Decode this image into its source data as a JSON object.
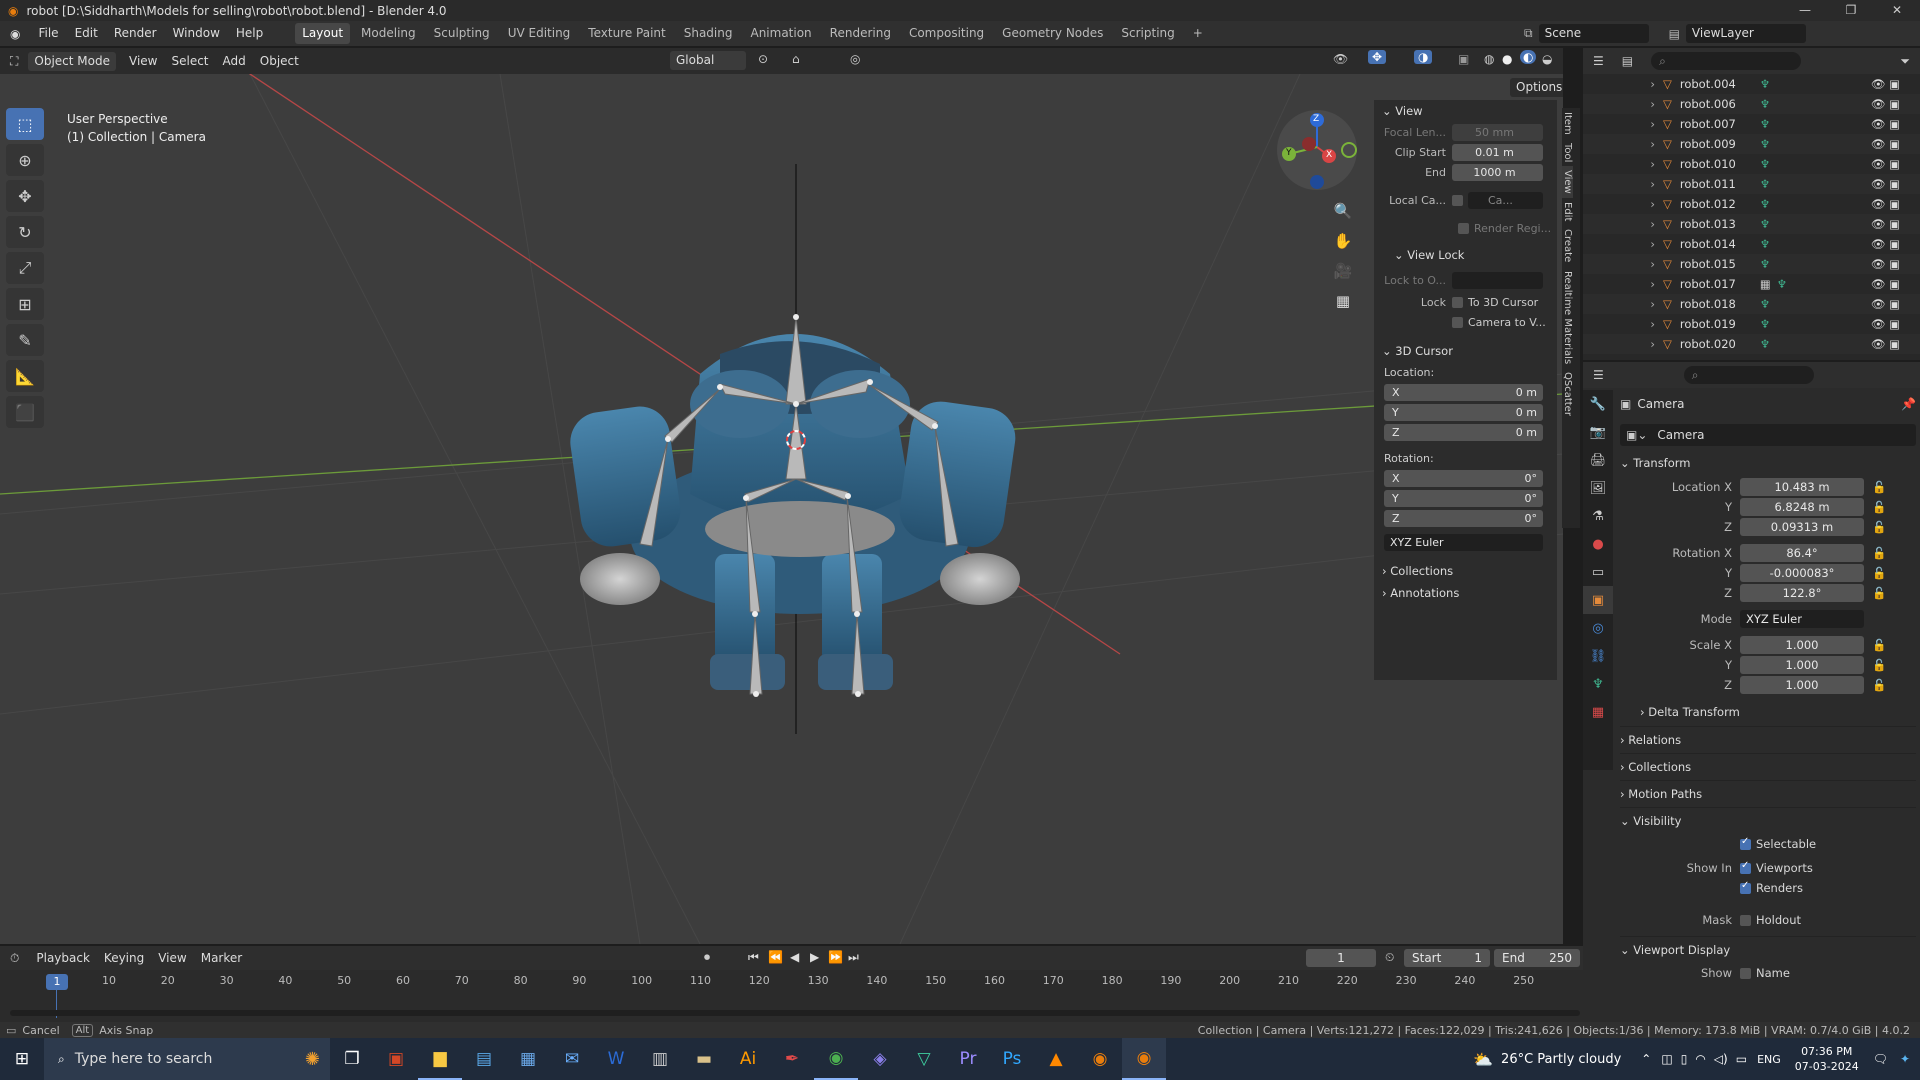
{
  "titlebar": {
    "title": "robot [D:\\Siddharth\\Models for selling\\robot\\robot.blend] - Blender 4.0",
    "min": "—",
    "max": "❐",
    "close": "✕"
  },
  "menubar": {
    "items": [
      "File",
      "Edit",
      "Render",
      "Window",
      "Help"
    ],
    "workspaces": [
      "Layout",
      "Modeling",
      "Sculpting",
      "UV Editing",
      "Texture Paint",
      "Shading",
      "Animation",
      "Rendering",
      "Compositing",
      "Geometry Nodes",
      "Scripting"
    ],
    "add_tab": "+",
    "scene_label": "Scene",
    "viewlayer_label": "ViewLayer"
  },
  "viewport_header": {
    "mode": "Object Mode",
    "menus": [
      "View",
      "Select",
      "Add",
      "Object"
    ],
    "orientation": "Global",
    "options": "Options"
  },
  "viewport": {
    "perspective": "User Perspective",
    "collection_info": "(1) Collection | Camera"
  },
  "gizmo": {
    "x": "X",
    "y": "Y",
    "z": "Z"
  },
  "npanel": {
    "view_title": "View",
    "focal_label": "Focal Len...",
    "focal_value": "50 mm",
    "clip_start_label": "Clip Start",
    "clip_start_value": "0.01 m",
    "clip_end_label": "End",
    "clip_end_value": "1000 m",
    "local_cam_label": "Local Ca...",
    "local_cam_value": "Ca...",
    "render_region": "Render Regi...",
    "view_lock_title": "View Lock",
    "lock_to_label": "Lock to O...",
    "lock_label": "Lock",
    "lock_cursor": "To 3D Cursor",
    "lock_camera": "Camera to V...",
    "cursor_title": "3D Cursor",
    "location_label": "Location:",
    "loc_x": "0 m",
    "loc_y": "0 m",
    "loc_z": "0 m",
    "rotation_label": "Rotation:",
    "rot_x": "0°",
    "rot_y": "0°",
    "rot_z": "0°",
    "rotation_mode": "XYZ Euler",
    "collections": "Collections",
    "annotations": "Annotations",
    "x": "X",
    "y": "Y",
    "z": "Z"
  },
  "npanel_tabs": [
    "Item",
    "Tool",
    "View",
    "Edit",
    "Create",
    "Realtime Materials",
    "QScatter"
  ],
  "outliner": {
    "rows": [
      "robot.004",
      "robot.006",
      "robot.007",
      "robot.009",
      "robot.010",
      "robot.011",
      "robot.012",
      "robot.013",
      "robot.014",
      "robot.015",
      "robot.017",
      "robot.018",
      "robot.019",
      "robot.020"
    ]
  },
  "properties": {
    "object_name": "Camera",
    "datablock_name": "Camera",
    "transform_title": "Transform",
    "loc_x_label": "Location X",
    "loc_x": "10.483 m",
    "loc_y": "6.8248 m",
    "loc_z": "0.09313 m",
    "rot_x_label": "Rotation X",
    "rot_x": "86.4°",
    "rot_y": "-0.000083°",
    "rot_z": "122.8°",
    "mode_label": "Mode",
    "mode_value": "XYZ Euler",
    "scale_x_label": "Scale X",
    "scale_x": "1.000",
    "scale_y": "1.000",
    "scale_z": "1.000",
    "delta_transform": "Delta Transform",
    "relations": "Relations",
    "collections": "Collections",
    "motion_paths": "Motion Paths",
    "visibility": "Visibility",
    "selectable": "Selectable",
    "show_in_label": "Show In",
    "viewports": "Viewports",
    "renders": "Renders",
    "mask_label": "Mask",
    "holdout": "Holdout",
    "viewport_display": "Viewport Display",
    "show_label": "Show",
    "name_label": "Name",
    "y": "Y",
    "z": "Z"
  },
  "timeline": {
    "menus": [
      "Playback",
      "Keying",
      "View",
      "Marker"
    ],
    "current_frame": "1",
    "start_label": "Start",
    "start_value": "1",
    "end_label": "End",
    "end_value": "250",
    "playhead": "1",
    "ticks": [
      "10",
      "20",
      "30",
      "40",
      "50",
      "60",
      "70",
      "80",
      "90",
      "100",
      "110",
      "120",
      "130",
      "140",
      "150",
      "160",
      "170",
      "180",
      "190",
      "200",
      "210",
      "220",
      "230",
      "240",
      "250"
    ]
  },
  "statusbar": {
    "cancel": "Cancel",
    "alt_key": "Alt",
    "axis_snap": "Axis Snap",
    "stats": "Collection | Camera | Verts:121,272 | Faces:122,029 | Tris:241,626 | Objects:1/36 | Memory: 173.8 MiB | VRAM: 0.7/4.0 GiB | 4.0.2"
  },
  "taskbar": {
    "search_placeholder": "Type here to search",
    "weather": "26°C  Partly cloudy",
    "lang": "ENG",
    "time": "07:36 PM",
    "date": "07-03-2024"
  }
}
